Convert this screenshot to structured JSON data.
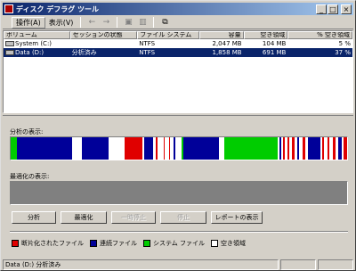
{
  "window": {
    "title": "ディスク デフラグ ツール"
  },
  "menu": {
    "items": [
      "操作(A)",
      "表示(V)"
    ]
  },
  "toolbar": {
    "icons": [
      "back-icon",
      "forward-icon",
      "up-folder-icon",
      "view-icon",
      "help-icon"
    ]
  },
  "volumes": {
    "headers": [
      "ボリューム",
      "セッションの状態",
      "ファイル システム",
      "容量",
      "空き領域",
      "% 空き領域"
    ],
    "rows": [
      {
        "volume": "System (C:)",
        "status": "",
        "fs": "NTFS",
        "capacity": "2,047 MB",
        "free": "104 MB",
        "pct": "5 %"
      },
      {
        "volume": "Data (D:)",
        "status": "分析済み",
        "fs": "NTFS",
        "capacity": "1,858 MB",
        "free": "691 MB",
        "pct": "37 %"
      }
    ]
  },
  "analysis": {
    "label": "分析の表示:"
  },
  "defrag": {
    "label": "最適化の表示:"
  },
  "buttons": {
    "analyze": "分析",
    "defragment": "最適化",
    "pause": "一時停止",
    "stop": "停止",
    "report": "レポートの表示"
  },
  "legend": {
    "fragmented": "断片化されたファイル",
    "contiguous": "連続ファイル",
    "system": "システム ファイル",
    "free": "空き領域"
  },
  "colors": {
    "fragmented": "#e00000",
    "contiguous": "#000099",
    "system": "#00cc00",
    "free": "#ffffff"
  },
  "status": {
    "text": "Data (D:) 分析済み"
  }
}
